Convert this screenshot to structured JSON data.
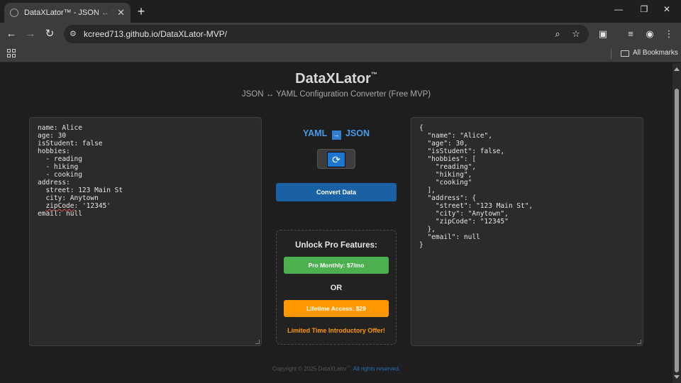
{
  "browser": {
    "tab_title": "DataXLator™ - JSON ↔ YAML Tr",
    "tab_close": "✕",
    "new_tab": "+",
    "url": "kcreed713.github.io/DataXLator-MVP/",
    "bookmarks_label": "All Bookmarks"
  },
  "page": {
    "title": "DataXLator",
    "title_mark": "™",
    "subtitle": "JSON ↔ YAML Configuration Converter (Free MVP)",
    "input_before_zip": "name: Alice\nage: 30\nisStudent: false\nhobbies:\n  - reading\n  - hiking\n  - cooking\naddress:\n  street: 123 Main St\n  city: Anytown\n  ",
    "input_zip_key": "zipCode",
    "input_after_zip": ": '12345'\nemail: null",
    "output_text": "{\n  \"name\": \"Alice\",\n  \"age\": 30,\n  \"isStudent\": false,\n  \"hobbies\": [\n    \"reading\",\n    \"hiking\",\n    \"cooking\"\n  ],\n  \"address\": {\n    \"street\": \"123 Main St\",\n    \"city\": \"Anytown\",\n    \"zipCode\": \"12345\"\n  },\n  \"email\": null\n}",
    "mode_from": "YAML",
    "mode_arrow": "→",
    "mode_to": "JSON",
    "toggle_icon": "⟳",
    "convert_label": "Convert Data",
    "pro_title": "Unlock Pro Features:",
    "pro_monthly": "Pro Monthly: $7/mo",
    "pro_or": "OR",
    "pro_lifetime": "Lifetime Access: $29",
    "pro_offer": "Limited Time Introductory Offer!",
    "footer_prefix": "Copyright © 2025 DataXLator",
    "footer_mark": "™",
    "footer_rights": ". All rights reserved."
  },
  "colors": {
    "accent": "#1961a3",
    "mode_text": "#4a9be8",
    "monthly": "#4caf50",
    "lifetime": "#ff9800"
  }
}
